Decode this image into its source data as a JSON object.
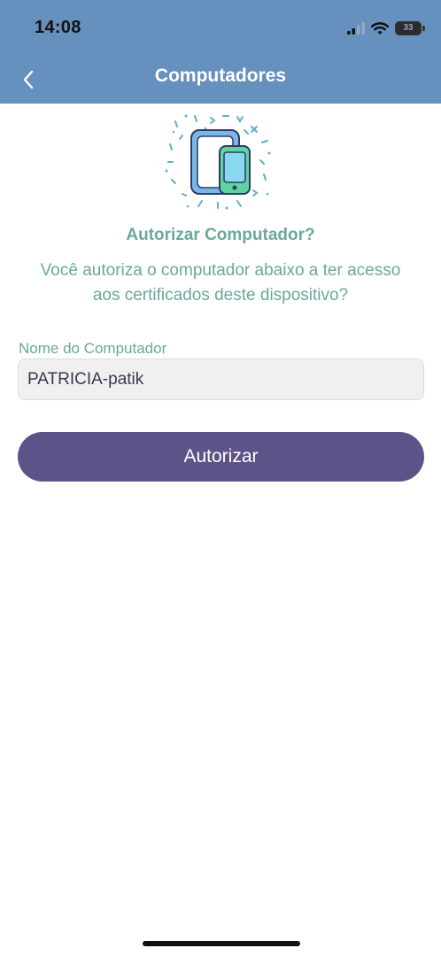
{
  "status_bar": {
    "time": "14:08",
    "battery": "33",
    "icons": [
      "cellular-signal-icon",
      "wifi-icon",
      "battery-icon"
    ]
  },
  "nav": {
    "back_icon": "chevron-left-icon",
    "title": "Computadores"
  },
  "illustration": {
    "icon": "tablet-phone-devices-icon"
  },
  "content": {
    "title": "Autorizar Computador?",
    "description": "Você autoriza o computador abaixo a ter acesso aos certificados deste dispositivo?",
    "field_label": "Nome do Computador",
    "field_value": "PATRICIA-patik",
    "button_label": "Autorizar"
  },
  "colors": {
    "header_bg": "#6690bd",
    "accent_text": "#6aa89b",
    "button_bg": "#5d5389",
    "input_bg": "#f0f0f1",
    "input_text": "#3f3650"
  }
}
